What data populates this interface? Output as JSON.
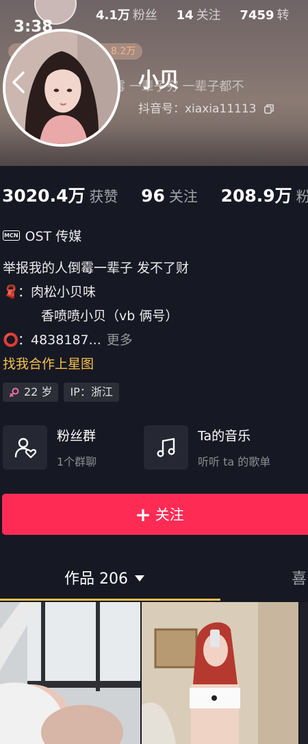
{
  "status_bar": {
    "time": "3:38"
  },
  "ghost_header": {
    "fans_num": "4.1万",
    "fans_label": "粉丝",
    "follow_num": "14",
    "follow_label": "关注",
    "third_num": "7459",
    "third_label": "转",
    "pill_text": "8.2万",
    "ghost_bio": "霉 一辈子穷 一辈子都不"
  },
  "profile": {
    "name": "小贝",
    "douyin_id": "抖音号：xiaxia11113"
  },
  "stats": [
    {
      "num": "3020.4万",
      "label": "获赞"
    },
    {
      "num": "96",
      "label": "关注"
    },
    {
      "num": "208.9万",
      "label": "粉"
    }
  ],
  "mcn": {
    "badge": "MCN",
    "org": "OST 传媒"
  },
  "bio": {
    "line1": "举报我的人倒霉一辈子 发不了财",
    "line2_emoji": "🧣",
    "line2": "：肉松小贝味",
    "line3": "香喷喷小贝（vb 俩号）",
    "line4_emoji": "⭕",
    "line4": "：4838187...",
    "more": "更多"
  },
  "star_link": "找我合作上星图",
  "tags": {
    "age": "22 岁",
    "ip": "IP：浙江",
    "gender_icon": "female-symbol"
  },
  "features": [
    {
      "title": "粉丝群",
      "subtitle": "1个群聊",
      "icon": "group-heart-icon"
    },
    {
      "title": "Ta的音乐",
      "subtitle": "听听 ta 的歌单",
      "icon": "music-note-icon"
    }
  ],
  "follow_button": {
    "label": "关注",
    "plus": "+"
  },
  "tabs": {
    "works": "作品 206",
    "likes": "喜"
  },
  "colors": {
    "accent": "#fe2c55",
    "highlight": "#f7c04a",
    "background": "#161823"
  }
}
